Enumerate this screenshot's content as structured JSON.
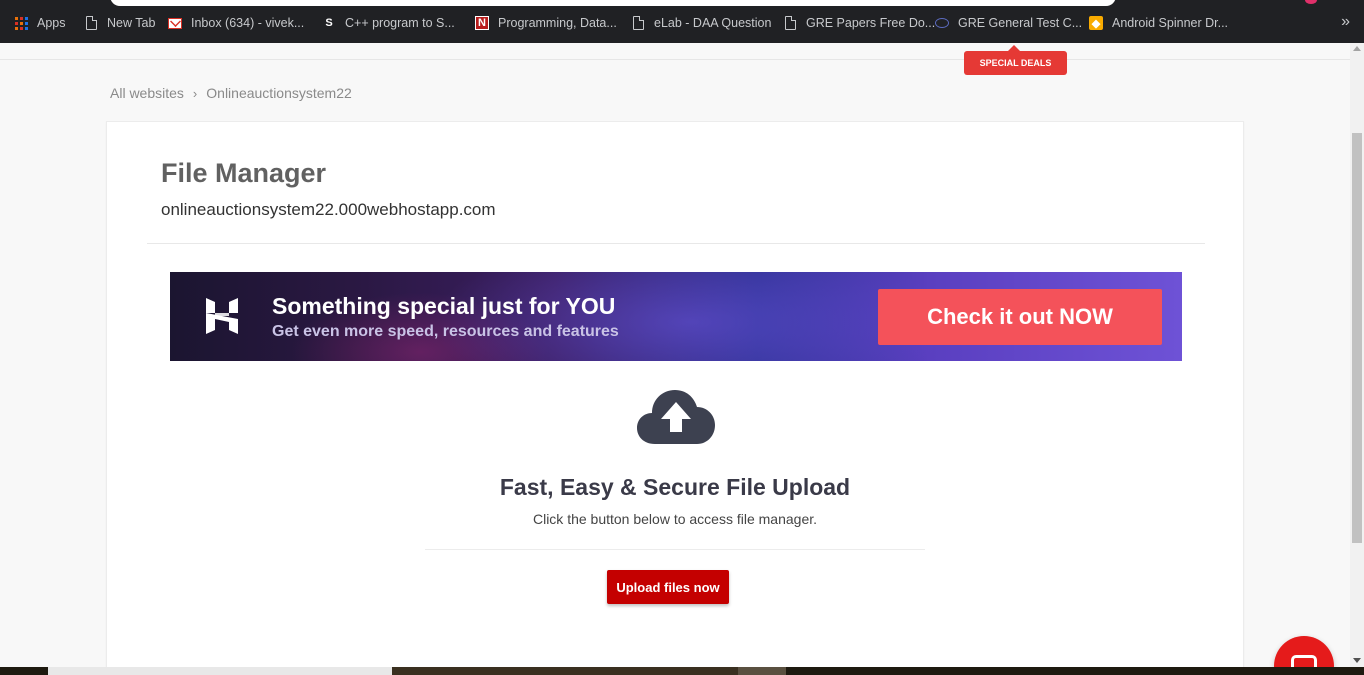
{
  "bookmarks": [
    {
      "label": "Apps",
      "icon": "apps-grid-icon"
    },
    {
      "label": "New Tab",
      "icon": "page-icon"
    },
    {
      "label": "Inbox (634) - vivek...",
      "icon": "gmail-icon"
    },
    {
      "label": "C++ program to S...",
      "icon": "s-icon"
    },
    {
      "label": "Programming, Data...",
      "icon": "n-icon"
    },
    {
      "label": "eLab - DAA Question",
      "icon": "page-icon"
    },
    {
      "label": "GRE Papers Free Do...",
      "icon": "page-icon"
    },
    {
      "label": "GRE General Test C...",
      "icon": "gre-icon"
    },
    {
      "label": "Android Spinner Dr...",
      "icon": "android-icon"
    }
  ],
  "bookmarks_more": "»",
  "special_deals": "SPECIAL DEALS",
  "breadcrumb": {
    "root": "All websites",
    "separator": "›",
    "current": "Onlineauctionsystem22"
  },
  "file_manager": {
    "title": "File Manager",
    "domain": "onlineauctionsystem22.000webhostapp.com"
  },
  "banner": {
    "headline": "Something special just for YOU",
    "subline": "Get even more speed, resources and features",
    "cta": "Check it out NOW"
  },
  "upload": {
    "title": "Fast, Easy & Secure File Upload",
    "description": "Click the button below to access file manager.",
    "button": "Upload files now"
  },
  "colors": {
    "accent_red": "#c40000",
    "chat_red": "#e51b1b",
    "cta_coral": "#f4525a",
    "bookmarks_bg": "#202124"
  }
}
